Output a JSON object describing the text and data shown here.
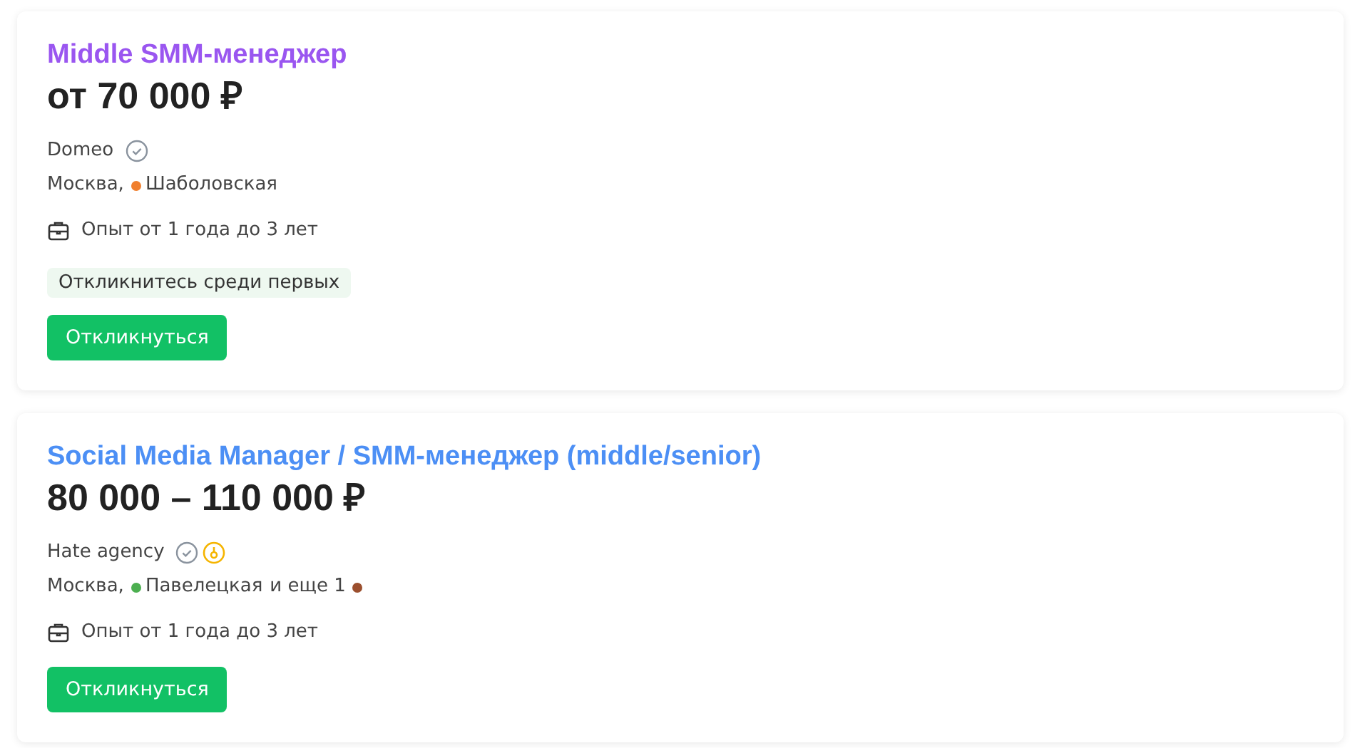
{
  "vacancies": [
    {
      "title": "Middle SMM-менеджер",
      "visited": true,
      "salary": "от 70 000 ₽",
      "company": "Domeo",
      "company_icons": [
        {
          "kind": "verified"
        }
      ],
      "city": "Москва,",
      "metro": [
        {
          "name": "Шаболовская",
          "color": "#f07f2e"
        }
      ],
      "experience": "Опыт от 1 года до 3 лет",
      "tag": "Откликнитесь среди первых",
      "button": "Откликнуться"
    },
    {
      "title": "Social Media Manager / SMM-менеджер (middle/senior)",
      "visited": false,
      "salary": "80 000 – 110 000 ₽",
      "company": "Hate agency",
      "company_icons": [
        {
          "kind": "verified"
        },
        {
          "kind": "award"
        }
      ],
      "city": "Москва,",
      "metro": [
        {
          "name": "Павелецкая",
          "color": "#4caf50"
        }
      ],
      "metro_more": {
        "text": "и еще 1",
        "color": "#9b4f2e"
      },
      "experience": "Опыт от 1 года до 3 лет",
      "button": "Откликнуться"
    }
  ]
}
